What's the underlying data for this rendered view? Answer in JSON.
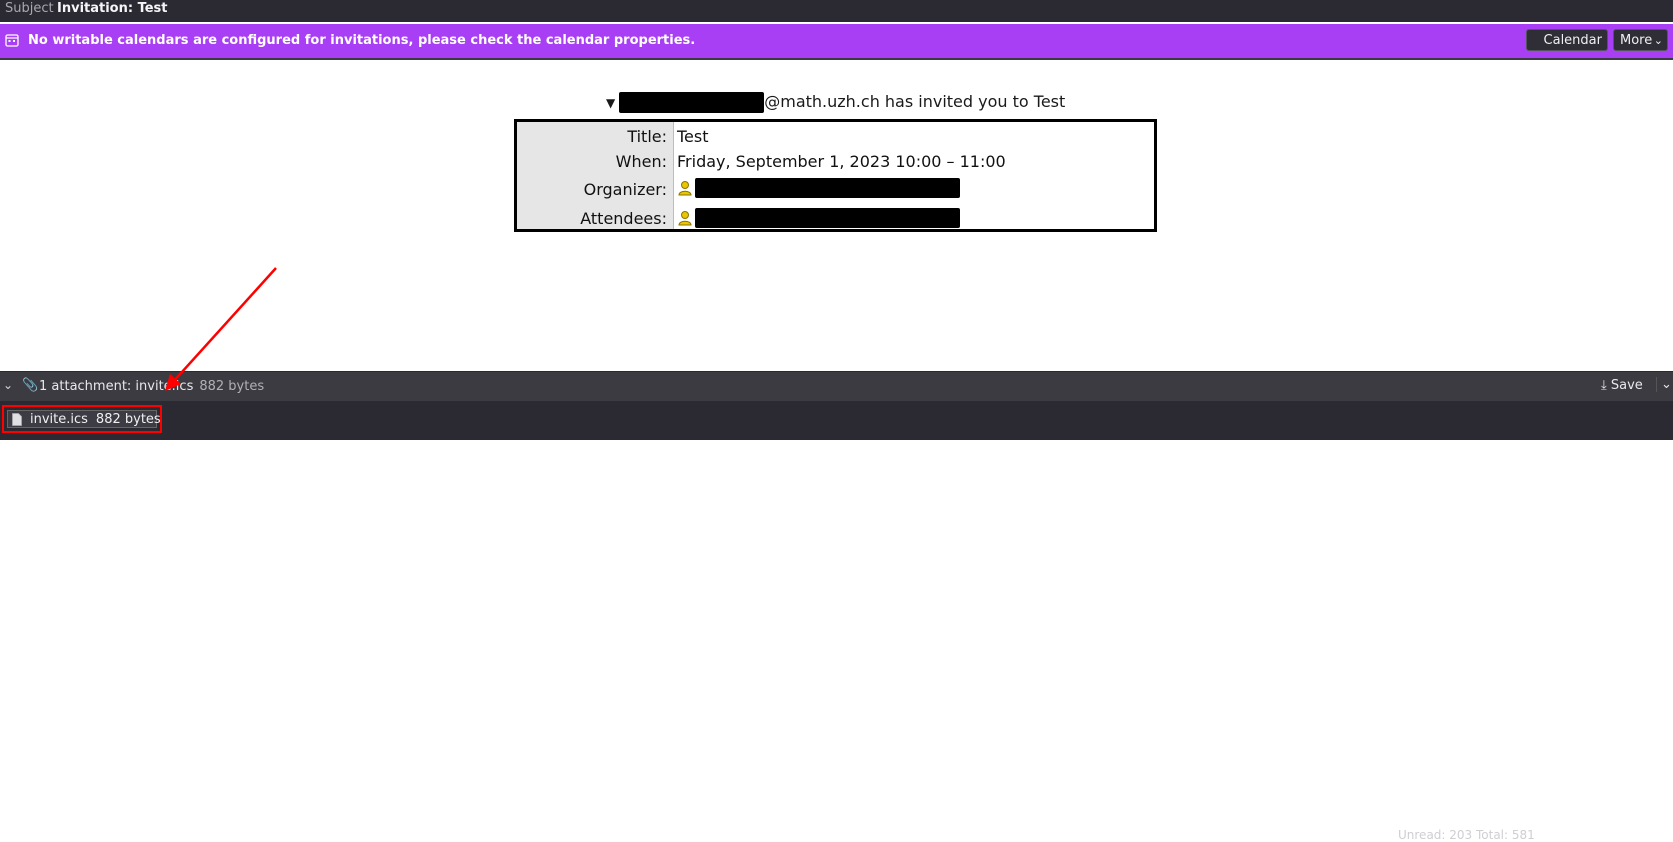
{
  "header": {
    "subject_label": "Subject",
    "subject_value": "Invitation: Test"
  },
  "notification": {
    "message": "No writable calendars are configured for invitations, please check the calendar properties.",
    "calendar_button": "Calendar",
    "more_button": "More",
    "bar_color": "#a83ff5"
  },
  "invitation": {
    "inviter_suffix": "@math.uzh.ch has invited you to Test",
    "rows": {
      "title_label": "Title:",
      "title_value": "Test",
      "when_label": "When:",
      "when_value": "Friday, September 1, 2023 10:00 – 11:00",
      "organizer_label": "Organizer:",
      "attendees_label": "Attendees:"
    }
  },
  "attachments": {
    "summary": "1 attachment: invite.ics",
    "summary_size": "882 bytes",
    "save_label": "Save",
    "items": [
      {
        "name": "invite.ics",
        "size": "882 bytes"
      }
    ]
  },
  "status": {
    "partial_text": "Unread: 203    Total: 581"
  },
  "colors": {
    "highlight": "#ff0000",
    "dark_bar": "#2b2a33"
  }
}
